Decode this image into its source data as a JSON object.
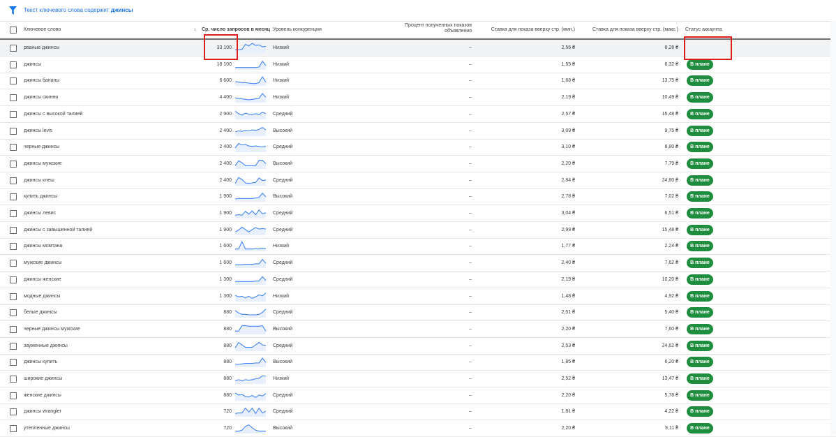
{
  "filter": {
    "prefix": "Текст ключевого слова содержит",
    "term": "джинсы"
  },
  "columns": {
    "keyword": "Ключевое слово",
    "sort_arrow": "↓",
    "volume": "Ср. число запросов в месяц",
    "competition": "Уровень конкуренции",
    "impression_share_line1": "Процент полученных показов",
    "impression_share_line2": "объявления",
    "bid_low": "Ставка для показа вверху стр. (мин.)",
    "bid_high": "Ставка для показа вверху стр. (макс.)",
    "account_status": "Статус аккаунта"
  },
  "badge_label": "В плане",
  "colors": {
    "accent": "#1a73e8",
    "badge": "#1e8e3e",
    "highlight": "#e01b1b",
    "spark": "#4285f4"
  },
  "rows": [
    {
      "keyword": "рваные джинсы",
      "volume": "33 100",
      "competition": "Низкий",
      "impression": "–",
      "bid_low": "2,56 ₴",
      "bid_high": "8,28 ₴",
      "badge": false,
      "trend": [
        0.3,
        0.3,
        0.35,
        0.85,
        0.7,
        0.95,
        0.75,
        0.8,
        0.6,
        0.65
      ]
    },
    {
      "keyword": "джинсы",
      "volume": "18 100",
      "competition": "Низкий",
      "impression": "–",
      "bid_low": "1,55 ₴",
      "bid_high": "6,32 ₴",
      "badge": true,
      "trend": [
        0.2,
        0.2,
        0.2,
        0.2,
        0.2,
        0.2,
        0.2,
        0.25,
        0.85,
        0.4
      ]
    },
    {
      "keyword": "джинсы бананы",
      "volume": "6 600",
      "competition": "Низкий",
      "impression": "–",
      "bid_low": "1,68 ₴",
      "bid_high": "13,75 ₴",
      "badge": true,
      "trend": [
        0.4,
        0.35,
        0.3,
        0.3,
        0.25,
        0.2,
        0.2,
        0.3,
        0.9,
        0.35
      ]
    },
    {
      "keyword": "джинсы скинни",
      "volume": "4 400",
      "competition": "Низкий",
      "impression": "–",
      "bid_low": "2,19 ₴",
      "bid_high": "10,49 ₴",
      "badge": true,
      "trend": [
        0.45,
        0.4,
        0.35,
        0.3,
        0.25,
        0.3,
        0.35,
        0.4,
        0.9,
        0.5
      ]
    },
    {
      "keyword": "джинсы с высокой талией",
      "volume": "2 900",
      "competition": "Средний",
      "impression": "–",
      "bid_low": "2,57 ₴",
      "bid_high": "15,48 ₴",
      "badge": true,
      "trend": [
        0.8,
        0.55,
        0.4,
        0.6,
        0.5,
        0.45,
        0.55,
        0.45,
        0.7,
        0.55
      ]
    },
    {
      "keyword": "джинсы levis",
      "volume": "2 400",
      "competition": "Высокий",
      "impression": "–",
      "bid_low": "3,09 ₴",
      "bid_high": "9,75 ₴",
      "badge": true,
      "trend": [
        0.4,
        0.5,
        0.45,
        0.55,
        0.5,
        0.6,
        0.55,
        0.65,
        0.85,
        0.6
      ]
    },
    {
      "keyword": "черные джинсы",
      "volume": "2 400",
      "competition": "Средний",
      "impression": "–",
      "bid_low": "3,10 ₴",
      "bid_high": "8,80 ₴",
      "badge": true,
      "trend": [
        0.4,
        0.85,
        0.7,
        0.75,
        0.6,
        0.55,
        0.6,
        0.55,
        0.5,
        0.6
      ]
    },
    {
      "keyword": "джинсы мужские",
      "volume": "2 400",
      "competition": "Высокий",
      "impression": "–",
      "bid_low": "2,20 ₴",
      "bid_high": "7,79 ₴",
      "badge": true,
      "trend": [
        0.3,
        0.8,
        0.6,
        0.3,
        0.3,
        0.3,
        0.3,
        0.85,
        0.85,
        0.5
      ]
    },
    {
      "keyword": "джинсы клеш",
      "volume": "2 400",
      "competition": "Средний",
      "impression": "–",
      "bid_low": "2,84 ₴",
      "bid_high": "24,80 ₴",
      "badge": true,
      "trend": [
        0.2,
        0.8,
        0.6,
        0.25,
        0.2,
        0.25,
        0.3,
        0.75,
        0.5,
        0.55
      ]
    },
    {
      "keyword": "купить джинсы",
      "volume": "1 900",
      "competition": "Высокий",
      "impression": "–",
      "bid_low": "2,78 ₴",
      "bid_high": "7,02 ₴",
      "badge": true,
      "trend": [
        0.25,
        0.3,
        0.3,
        0.3,
        0.3,
        0.3,
        0.35,
        0.4,
        0.85,
        0.45
      ]
    },
    {
      "keyword": "джинсы левис",
      "volume": "1 900",
      "competition": "Средний",
      "impression": "–",
      "bid_low": "3,04 ₴",
      "bid_high": "6,51 ₴",
      "badge": true,
      "trend": [
        0.3,
        0.35,
        0.3,
        0.7,
        0.4,
        0.75,
        0.35,
        0.85,
        0.45,
        0.55
      ]
    },
    {
      "keyword": "джинсы с завышенной талией",
      "volume": "1 900",
      "competition": "Средний",
      "impression": "–",
      "bid_low": "2,99 ₴",
      "bid_high": "15,48 ₴",
      "badge": true,
      "trend": [
        0.3,
        0.5,
        0.8,
        0.55,
        0.3,
        0.55,
        0.75,
        0.6,
        0.65,
        0.6
      ]
    },
    {
      "keyword": "джинсы момтана",
      "volume": "1 600",
      "competition": "Низкий",
      "impression": "–",
      "bid_low": "1,77 ₴",
      "bid_high": "2,24 ₴",
      "badge": true,
      "trend": [
        0.2,
        0.2,
        0.95,
        0.2,
        0.2,
        0.2,
        0.25,
        0.2,
        0.3,
        0.25
      ]
    },
    {
      "keyword": "мужские джинсы",
      "volume": "1 600",
      "competition": "Средний",
      "impression": "–",
      "bid_low": "2,40 ₴",
      "bid_high": "7,62 ₴",
      "badge": true,
      "trend": [
        0.3,
        0.3,
        0.3,
        0.35,
        0.35,
        0.35,
        0.4,
        0.4,
        0.85,
        0.45
      ]
    },
    {
      "keyword": "джинсы женские",
      "volume": "1 300",
      "competition": "Средний",
      "impression": "–",
      "bid_low": "2,19 ₴",
      "bid_high": "10,20 ₴",
      "badge": true,
      "trend": [
        0.3,
        0.3,
        0.3,
        0.3,
        0.3,
        0.3,
        0.35,
        0.35,
        0.8,
        0.4
      ]
    },
    {
      "keyword": "модные джинсы",
      "volume": "1 300",
      "competition": "Низкий",
      "impression": "–",
      "bid_low": "1,48 ₴",
      "bid_high": "4,92 ₴",
      "badge": true,
      "trend": [
        0.6,
        0.45,
        0.5,
        0.35,
        0.5,
        0.3,
        0.45,
        0.65,
        0.55,
        0.85
      ]
    },
    {
      "keyword": "белые джинсы",
      "volume": "880",
      "competition": "Средний",
      "impression": "–",
      "bid_low": "2,51 ₴",
      "bid_high": "5,40 ₴",
      "badge": true,
      "trend": [
        0.7,
        0.45,
        0.3,
        0.3,
        0.25,
        0.25,
        0.25,
        0.3,
        0.5,
        0.85
      ]
    },
    {
      "keyword": "черные джинсы мужские",
      "volume": "880",
      "competition": "Высокий",
      "impression": "–",
      "bid_low": "2,20 ₴",
      "bid_high": "7,60 ₴",
      "badge": true,
      "trend": [
        0.3,
        0.3,
        0.85,
        0.85,
        0.8,
        0.8,
        0.8,
        0.8,
        0.85,
        0.3
      ]
    },
    {
      "keyword": "зауженные джинсы",
      "volume": "880",
      "competition": "Средний",
      "impression": "–",
      "bid_low": "2,53 ₴",
      "bid_high": "24,62 ₴",
      "badge": true,
      "trend": [
        0.3,
        0.85,
        0.6,
        0.35,
        0.35,
        0.35,
        0.6,
        0.85,
        0.6,
        0.55
      ]
    },
    {
      "keyword": "джинсы купить",
      "volume": "880",
      "competition": "Высокий",
      "impression": "–",
      "bid_low": "1,85 ₴",
      "bid_high": "6,20 ₴",
      "badge": true,
      "trend": [
        0.25,
        0.25,
        0.3,
        0.35,
        0.35,
        0.35,
        0.4,
        0.4,
        0.9,
        0.45
      ]
    },
    {
      "keyword": "широкие джинсы",
      "volume": "880",
      "competition": "Низкий",
      "impression": "–",
      "bid_low": "2,52 ₴",
      "bid_high": "13,47 ₴",
      "badge": true,
      "trend": [
        0.3,
        0.4,
        0.3,
        0.4,
        0.35,
        0.4,
        0.5,
        0.55,
        0.8,
        0.75
      ]
    },
    {
      "keyword": "женские джинсы",
      "volume": "880",
      "competition": "Средний",
      "impression": "–",
      "bid_low": "2,20 ₴",
      "bid_high": "5,78 ₴",
      "badge": true,
      "trend": [
        0.75,
        0.55,
        0.6,
        0.4,
        0.35,
        0.5,
        0.3,
        0.55,
        0.45,
        0.7
      ]
    },
    {
      "keyword": "джинсы wrangler",
      "volume": "720",
      "competition": "Средний",
      "impression": "–",
      "bid_low": "1,81 ₴",
      "bid_high": "4,22 ₴",
      "badge": true,
      "trend": [
        0.3,
        0.35,
        0.35,
        0.85,
        0.45,
        0.85,
        0.3,
        0.85,
        0.35,
        0.55
      ]
    },
    {
      "keyword": "утепленные джинсы",
      "volume": "720",
      "competition": "Высокий",
      "impression": "–",
      "bid_low": "2,20 ₴",
      "bid_high": "9,11 ₴",
      "badge": true,
      "trend": [
        0.2,
        0.2,
        0.3,
        0.7,
        0.85,
        0.55,
        0.3,
        0.2,
        0.2,
        0.2
      ]
    }
  ]
}
